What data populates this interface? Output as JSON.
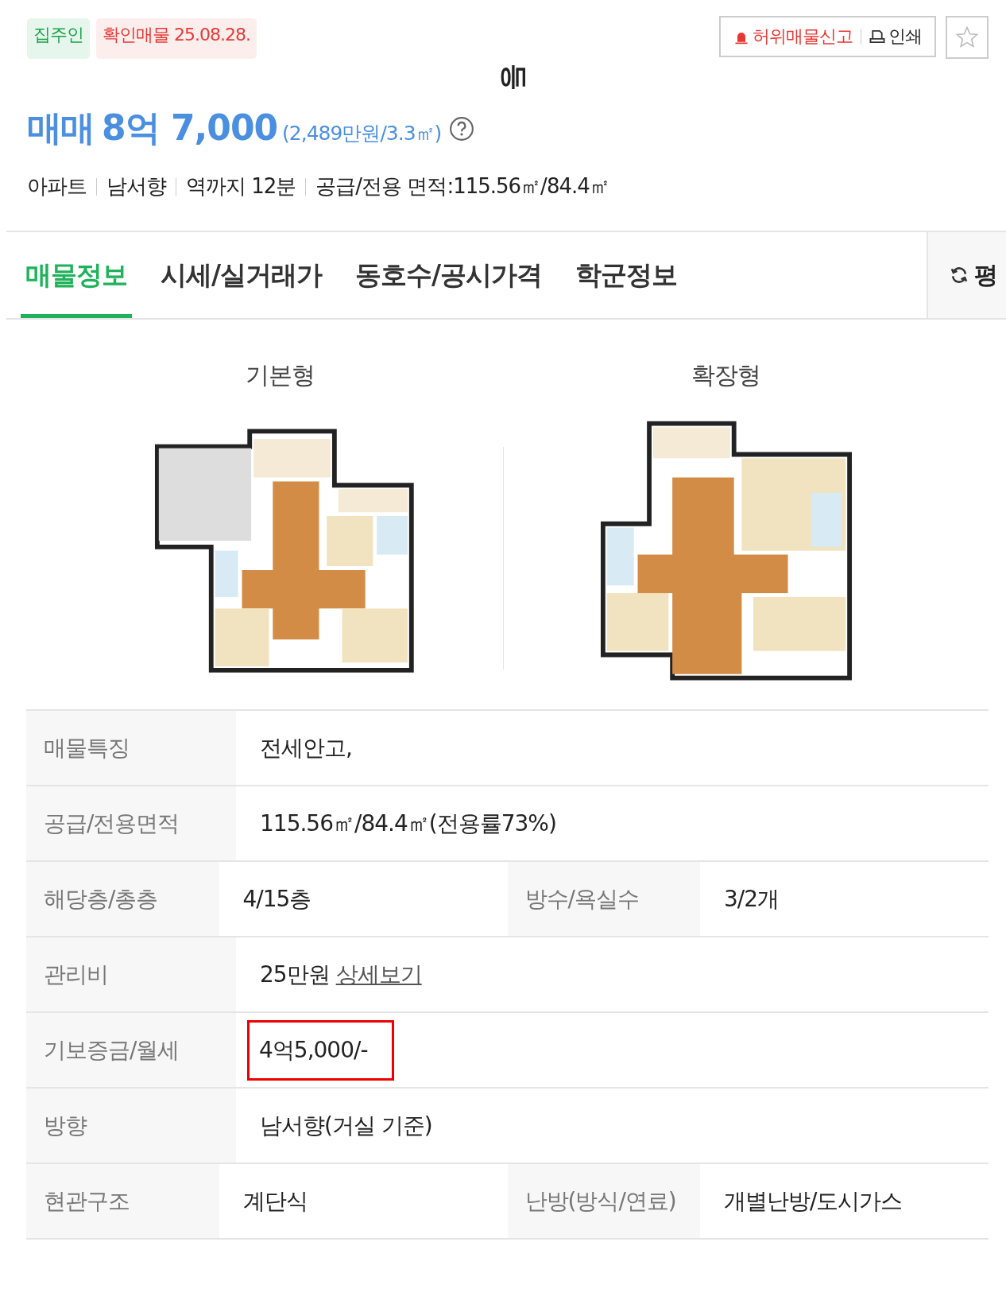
{
  "badges": [
    {
      "label": "집주인",
      "kind": "owner"
    },
    {
      "label": "확인매물 25.08.28.",
      "kind": "verified"
    }
  ],
  "actions": {
    "report": "허위매물신고",
    "print": "인쇄",
    "favorite": false
  },
  "title_fragment": "등",
  "price": {
    "type": "매매",
    "amount": "8억 7,000",
    "unit_price": "(2,489만원/3.3㎡)"
  },
  "summary": [
    "아파트",
    "남서향",
    "역까지 12분",
    "공급/전용 면적:115.56㎡/84.4㎡"
  ],
  "tabs": [
    {
      "label": "매물정보",
      "selected": true
    },
    {
      "label": "시세/실거래가",
      "selected": false
    },
    {
      "label": "동호수/공시가격",
      "selected": false
    },
    {
      "label": "학군정보",
      "selected": false
    }
  ],
  "unit_toggle": "평",
  "floor_plans": [
    {
      "label": "기본형",
      "kind": "picture"
    },
    {
      "label": "확장형",
      "kind": "picture"
    }
  ],
  "details": [
    {
      "cells": [
        {
          "label": "매물특징",
          "value": "전세안고,"
        }
      ]
    },
    {
      "cells": [
        {
          "label": "공급/전용면적",
          "value": "115.56㎡/84.4㎡(전용률73%)"
        }
      ]
    },
    {
      "cells": [
        {
          "label": "해당층/총층",
          "value": "4/15층"
        },
        {
          "label": "방수/욕실수",
          "value": "3/2개"
        }
      ]
    },
    {
      "cells": [
        {
          "label": "관리비",
          "value": "25만원",
          "link": "상세보기"
        }
      ]
    },
    {
      "cells": [
        {
          "label": "기보증금/월세",
          "value": "4억5,000/-",
          "highlighted": true
        }
      ]
    },
    {
      "cells": [
        {
          "label": "방향",
          "value": "남서향(거실 기준)"
        }
      ]
    },
    {
      "cells": [
        {
          "label": "현관구조",
          "value": "계단식"
        },
        {
          "label": "난방(방식/연료)",
          "value": "개별난방/도시가스"
        }
      ]
    }
  ]
}
